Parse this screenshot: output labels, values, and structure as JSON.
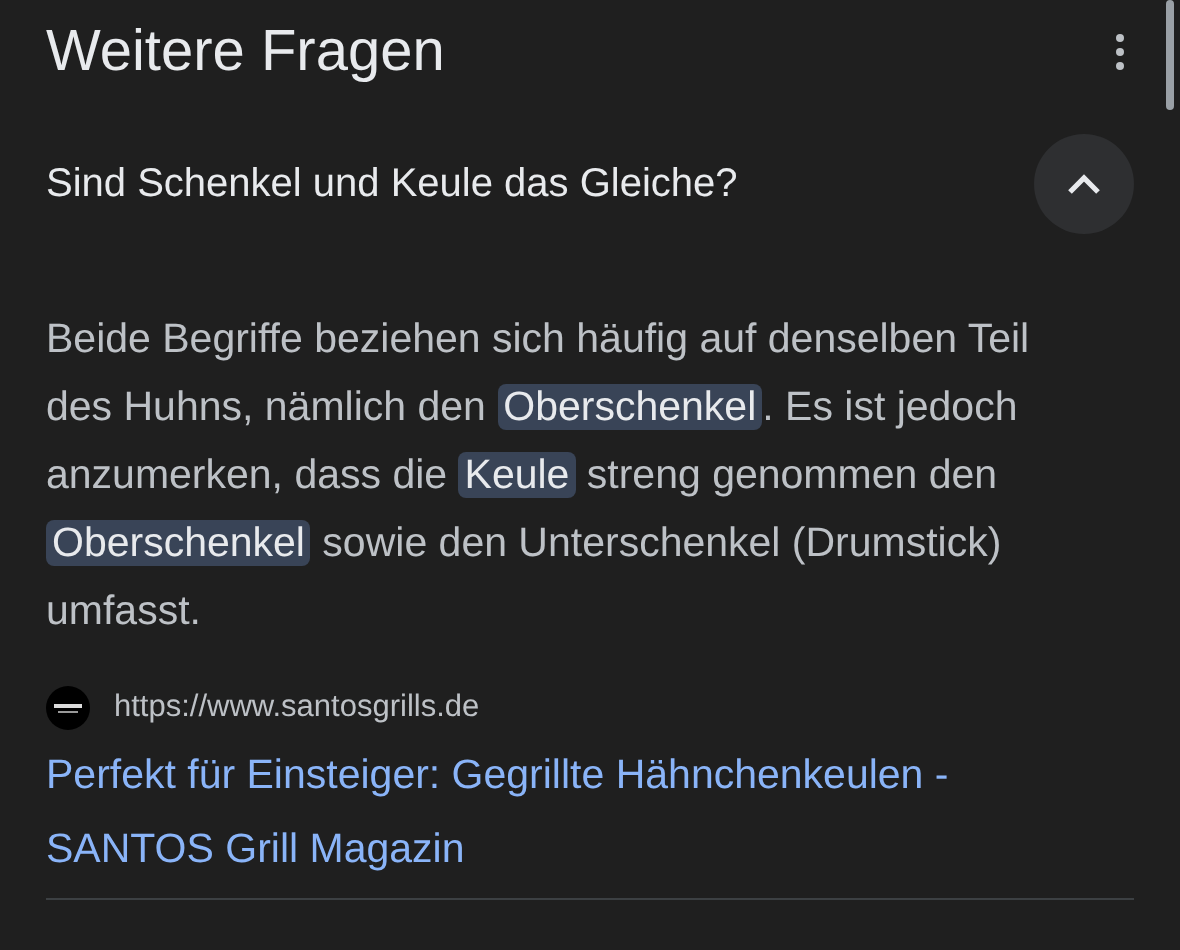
{
  "section_title": "Weitere Fragen",
  "questions": [
    {
      "question": "Sind Schenkel und Keule das Gleiche?",
      "expanded": true,
      "answer": [
        {
          "text": "Beide Begriffe beziehen sich häufig auf denselben Teil des Huhns, nämlich den ",
          "highlighted": false
        },
        {
          "text": "Oberschenkel",
          "highlighted": true
        },
        {
          "text": ". Es ist jedoch anzumerken, dass die ",
          "highlighted": false
        },
        {
          "text": "Keule",
          "highlighted": true
        },
        {
          "text": " streng genommen den ",
          "highlighted": false
        },
        {
          "text": "Oberschenkel",
          "highlighted": true
        },
        {
          "text": " sowie den Unterschenkel (Drumstick) umfasst.",
          "highlighted": false
        }
      ],
      "source": {
        "url": "https://www.santosgrills.de",
        "title": "Perfekt für Einsteiger: Gegrillte Hähnchenkeulen - SANTOS Grill Magazin"
      }
    }
  ]
}
